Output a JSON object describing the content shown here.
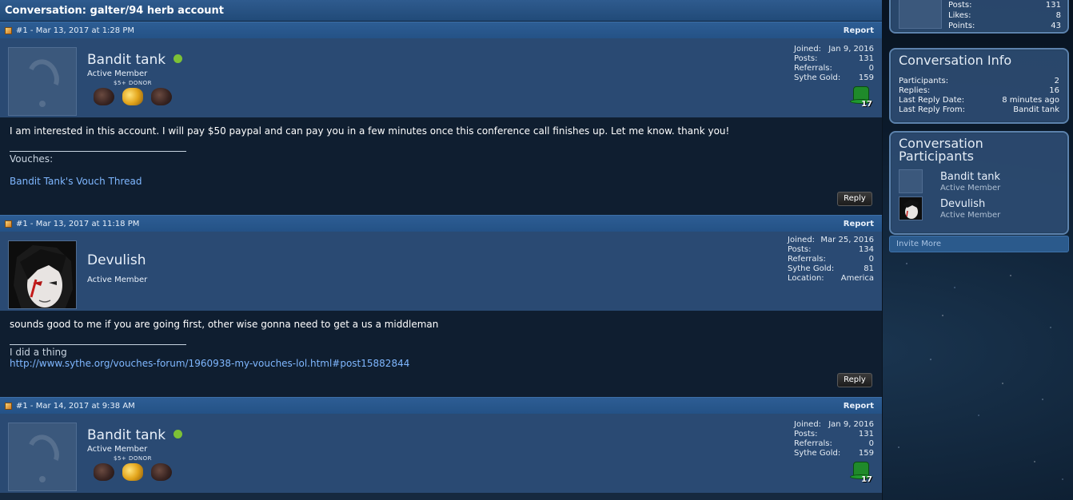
{
  "conversation_title": "Conversation: galter/94 herb account",
  "posts": [
    {
      "meta": "#1 - Mar 13, 2017 at 1:28 PM",
      "report": "Report",
      "username": "Bandit tank",
      "online": true,
      "user_title": "Active Member",
      "donor_label": "$5+ DONOR",
      "stats": [
        {
          "label": "Joined:",
          "value": "Jan 9, 2016"
        },
        {
          "label": "Posts:",
          "value": "131"
        },
        {
          "label": "Referrals:",
          "value": "0"
        },
        {
          "label": "Sythe Gold:",
          "value": "159"
        }
      ],
      "hat_number": "17",
      "message": "I am interested in this account. I will pay $50 paypal and can pay you in a few minutes once this conference call finishes up. Let me know. thank you!",
      "sig_label": "Vouches:",
      "sig_link": "Bandit Tank's Vouch Thread",
      "reply": "Reply"
    },
    {
      "meta": "#1 - Mar 13, 2017 at 11:18 PM",
      "report": "Report",
      "username": "Devulish",
      "online": false,
      "user_title": "Active Member",
      "stats": [
        {
          "label": "Joined:",
          "value": "Mar 25, 2016"
        },
        {
          "label": "Posts:",
          "value": "134"
        },
        {
          "label": "Referrals:",
          "value": "0"
        },
        {
          "label": "Sythe Gold:",
          "value": "81"
        },
        {
          "label": "Location:",
          "value": "America"
        }
      ],
      "message": "sounds good to me if you are going first, other wise gonna need to get a us a middleman",
      "sig_label": "I did a thing",
      "sig_link": "http://www.sythe.org/vouches-forum/1960938-my-vouches-lol.html#post15882844",
      "reply": "Reply"
    },
    {
      "meta": "#1 - Mar 14, 2017 at 9:38 AM",
      "report": "Report",
      "username": "Bandit tank",
      "online": true,
      "user_title": "Active Member",
      "donor_label": "$5+ DONOR",
      "stats": [
        {
          "label": "Joined:",
          "value": "Jan 9, 2016"
        },
        {
          "label": "Posts:",
          "value": "131"
        },
        {
          "label": "Referrals:",
          "value": "0"
        },
        {
          "label": "Sythe Gold:",
          "value": "159"
        }
      ],
      "hat_number": "17"
    }
  ],
  "sidebar": {
    "profile_stats": [
      {
        "label": "Posts:",
        "value": "131"
      },
      {
        "label": "Likes:",
        "value": "8"
      },
      {
        "label": "Points:",
        "value": "43"
      }
    ],
    "info_title": "Conversation Info",
    "info": [
      {
        "label": "Participants:",
        "value": "2"
      },
      {
        "label": "Replies:",
        "value": "16"
      },
      {
        "label": "Last Reply Date:",
        "value": "8 minutes ago"
      },
      {
        "label": "Last Reply From:",
        "value": "Bandit tank"
      }
    ],
    "participants_title": "Conversation Participants",
    "participants": [
      {
        "name": "Bandit tank",
        "title": "Active Member"
      },
      {
        "name": "Devulish",
        "title": "Active Member"
      }
    ],
    "invite": "Invite More"
  },
  "colors": {
    "header_blue": "#2d5d94",
    "userbar_blue": "#2a4a73",
    "message_bg": "#0f1e30",
    "link": "#7fb7ff",
    "online_green": "#7dc136"
  },
  "icons": [
    "post-icon",
    "online-status-icon",
    "ore-badge-icon",
    "gold-coins-badge-icon",
    "leprechaun-hat-icon",
    "default-avatar-icon"
  ]
}
